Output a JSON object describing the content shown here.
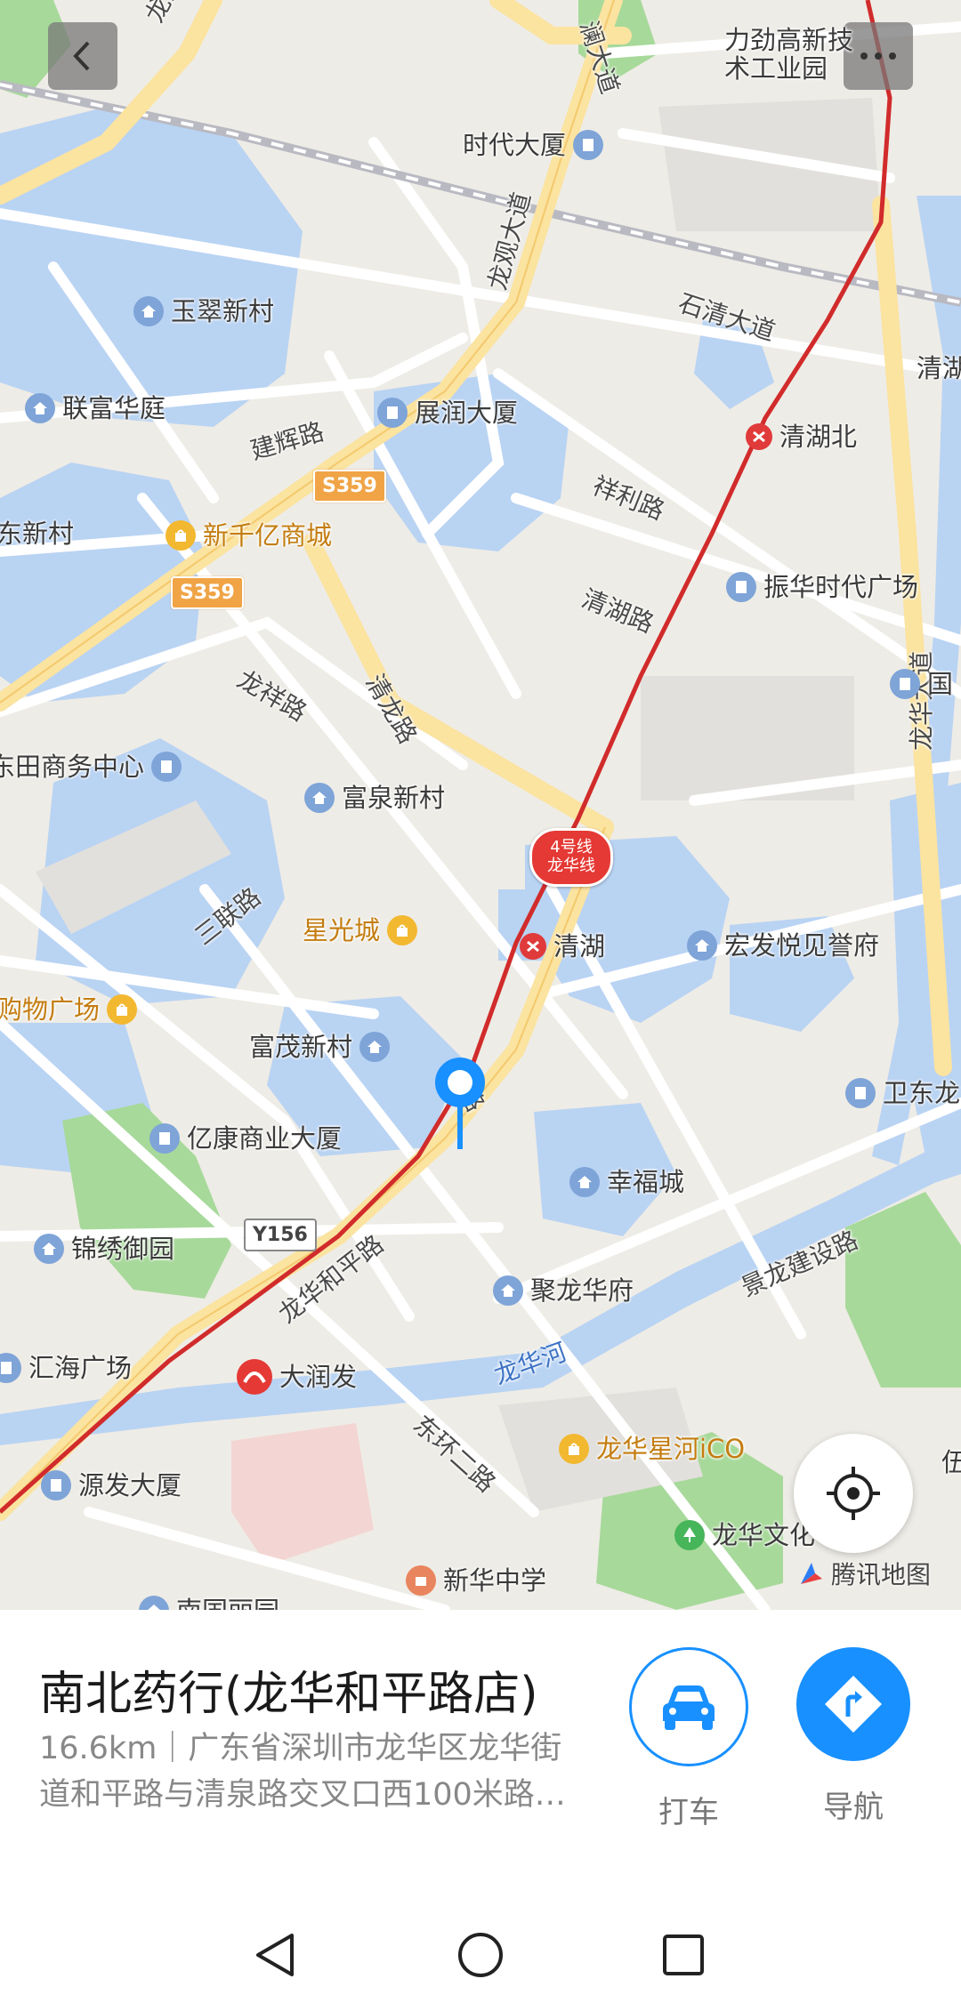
{
  "map": {
    "place_labels": [
      {
        "id": "lijin",
        "text": "力劲高新技\n术工业园",
        "icon": "none"
      },
      {
        "id": "shidai",
        "text": "时代大厦",
        "icon": "building"
      },
      {
        "id": "yucui",
        "text": "玉翠新村",
        "icon": "home"
      },
      {
        "id": "lianfu",
        "text": "联富华庭",
        "icon": "home"
      },
      {
        "id": "zhanrun",
        "text": "展润大厦",
        "icon": "building"
      },
      {
        "id": "xinqianyi",
        "text": "新千亿商城",
        "icon": "shop"
      },
      {
        "id": "qinghubei",
        "text": "清湖北",
        "icon": "metro"
      },
      {
        "id": "zhenhua",
        "text": "振华时代广场",
        "icon": "building"
      },
      {
        "id": "tiantian",
        "text": "东田商务中心",
        "icon": "building"
      },
      {
        "id": "fuquan",
        "text": "富泉新村",
        "icon": "home"
      },
      {
        "id": "xingguang",
        "text": "星光城",
        "icon": "shop"
      },
      {
        "id": "qinghu",
        "text": "清湖",
        "icon": "metro"
      },
      {
        "id": "hongfa",
        "text": "宏发悦见誉府",
        "icon": "home"
      },
      {
        "id": "gouwu",
        "text": "购物广场",
        "icon": "shop"
      },
      {
        "id": "fumao",
        "text": "富茂新村",
        "icon": "home"
      },
      {
        "id": "weidong",
        "text": "卫东龙",
        "icon": "building"
      },
      {
        "id": "yikang",
        "text": "亿康商业大厦",
        "icon": "building"
      },
      {
        "id": "xingfu",
        "text": "幸福城",
        "icon": "home"
      },
      {
        "id": "jinxiu",
        "text": "锦绣御园",
        "icon": "home"
      },
      {
        "id": "julong",
        "text": "聚龙华府",
        "icon": "home"
      },
      {
        "id": "huihai",
        "text": "汇海广场",
        "icon": "building"
      },
      {
        "id": "darunfa",
        "text": "大润发",
        "icon": "darunfa"
      },
      {
        "id": "xinghe",
        "text": "龙华星河iCO",
        "icon": "shop"
      },
      {
        "id": "yuanfa",
        "text": "源发大厦",
        "icon": "building"
      },
      {
        "id": "longhuawen",
        "text": "龙华文化",
        "icon": "park"
      },
      {
        "id": "xinhua",
        "text": "新华中学",
        "icon": "school"
      },
      {
        "id": "qinghu_r",
        "text": "清湖",
        "icon": "none"
      },
      {
        "id": "guo",
        "text": "国",
        "icon": "building"
      },
      {
        "id": "yizhi",
        "text": "伍",
        "icon": "none"
      },
      {
        "id": "dongxin",
        "text": "东新村",
        "icon": "none"
      },
      {
        "id": "nanguo",
        "text": "南国丽园",
        "icon": "home"
      }
    ],
    "road_labels": [
      {
        "id": "longlan",
        "text": "龙澜大道"
      },
      {
        "id": "lanlan",
        "text": "澜大道"
      },
      {
        "id": "longguan",
        "text": "龙观大道"
      },
      {
        "id": "shiqing",
        "text": "石清大道"
      },
      {
        "id": "jianhui",
        "text": "建辉路"
      },
      {
        "id": "xiangli",
        "text": "祥利路"
      },
      {
        "id": "qinghulu",
        "text": "清湖路"
      },
      {
        "id": "longxiang",
        "text": "龙祥路"
      },
      {
        "id": "qinglong",
        "text": "清龙路"
      },
      {
        "id": "longhuadadao",
        "text": "龙华大道"
      },
      {
        "id": "sanlian",
        "text": "三联路"
      },
      {
        "id": "qinglu",
        "text": "清路"
      },
      {
        "id": "heping",
        "text": "龙华和平路"
      },
      {
        "id": "jinglong",
        "text": "景龙建设路"
      },
      {
        "id": "longhuahe",
        "text": "龙华河"
      },
      {
        "id": "donghuan",
        "text": "东环二路"
      }
    ],
    "shields": [
      {
        "id": "s359a",
        "text": "S359"
      },
      {
        "id": "s359b",
        "text": "S359"
      },
      {
        "id": "y156",
        "text": "Y156"
      }
    ],
    "metro_line_badge": {
      "line": "4号线",
      "name": "龙华线"
    },
    "watermark": "腾讯地图",
    "colors": {
      "water": "#b9d3f3",
      "road": "#ffffff",
      "highway": "#fbe3a0",
      "metro": "#d12b2b",
      "park": "#a7d99a",
      "accent": "#1890ff"
    }
  },
  "place": {
    "title": "南北药行(龙华和平路店)",
    "address_line1": "16.6km｜广东省深圳市龙华区龙华街",
    "address_line2": "道和平路与清泉路交叉口西100米路…"
  },
  "actions": {
    "taxi": {
      "label": "打车",
      "icon": "car-icon"
    },
    "navigate": {
      "label": "导航",
      "icon": "navigation-icon"
    }
  },
  "system_nav": [
    "back",
    "home",
    "recents"
  ]
}
